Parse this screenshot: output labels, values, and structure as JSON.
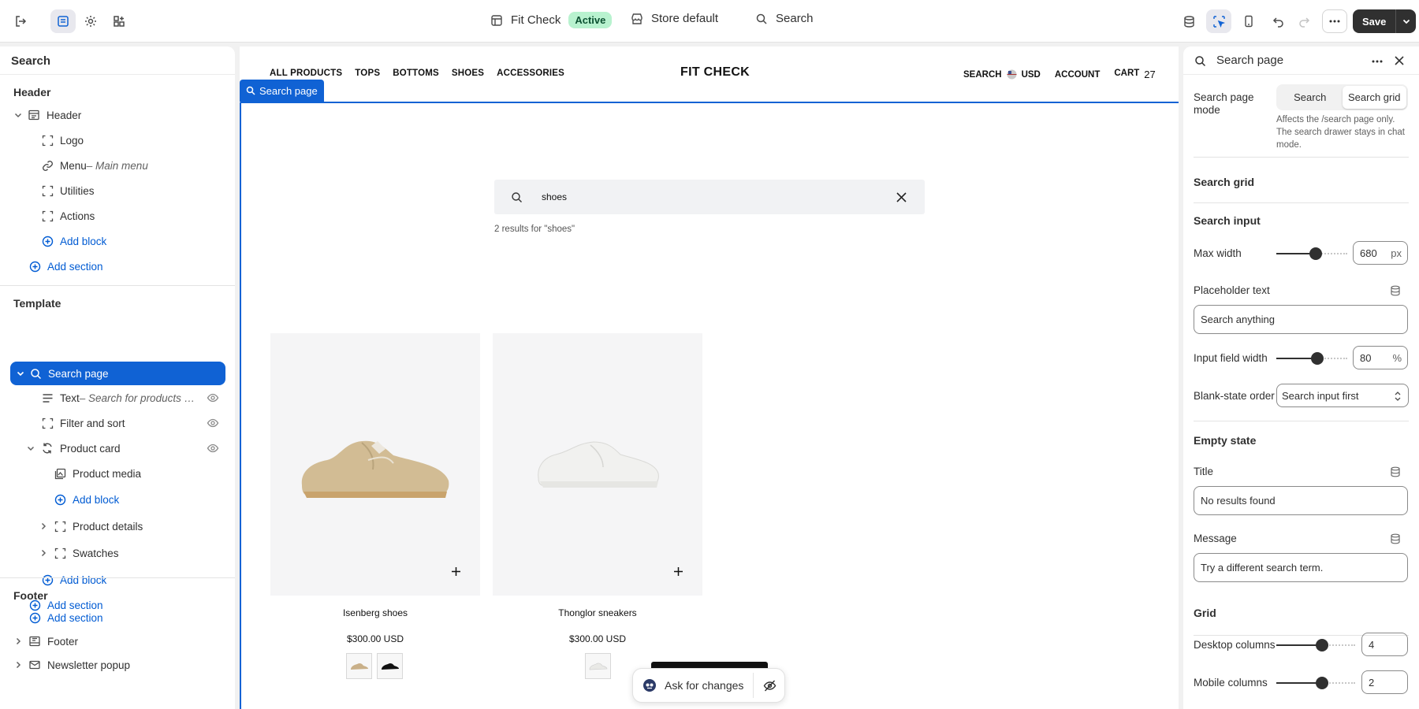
{
  "topbar": {
    "theme_name": "Fit Check",
    "theme_status": "Active",
    "store_label": "Store default",
    "search_label": "Search",
    "save_label": "Save"
  },
  "left_panel": {
    "title": "Search",
    "header_group": "Header",
    "header_section": "Header",
    "header_blocks": [
      {
        "label": "Logo",
        "sub": ""
      },
      {
        "label": "Menu",
        "sub": " – Main menu"
      },
      {
        "label": "Utilities",
        "sub": ""
      },
      {
        "label": "Actions",
        "sub": ""
      }
    ],
    "add_block": "Add block",
    "add_section": "Add section",
    "template_group": "Template",
    "template_section": "Search page",
    "template_blocks": {
      "text_label": "Text",
      "text_sub": " – Search for products Us...",
      "filter": "Filter and sort",
      "product_card": "Product card",
      "product_media": "Product media",
      "product_details": "Product details",
      "swatches": "Swatches"
    },
    "footer_group": "Footer",
    "footer_section": "Footer",
    "newsletter": "Newsletter popup"
  },
  "storefront": {
    "nav": [
      "ALL PRODUCTS",
      "TOPS",
      "BOTTOMS",
      "SHOES",
      "ACCESSORIES"
    ],
    "logo": "FIT CHECK",
    "search": "SEARCH",
    "currency": "USD",
    "account": "ACCOUNT",
    "cart": "CART",
    "cart_count": "27",
    "selection_tag": "Search page",
    "search_value": "shoes",
    "results_text": "2 results for \"shoes\"",
    "products": [
      {
        "name": "Isenberg shoes",
        "price": "$300.00 USD"
      },
      {
        "name": "Thonglor sneakers",
        "price": "$300.00 USD"
      }
    ],
    "ask_label": "Ask for changes"
  },
  "right_panel": {
    "title": "Search page",
    "mode_label": "Search page mode",
    "mode_options": [
      "Search",
      "Search grid"
    ],
    "mode_selected": "Search grid",
    "mode_help": "Affects the /search page only. The search drawer stays in chat mode.",
    "sec_search_grid": "Search grid",
    "sec_search_input": "Search input",
    "max_width_label": "Max width",
    "max_width_value": "680",
    "max_width_unit": "px",
    "placeholder_label": "Placeholder text",
    "placeholder_value": "Search anything",
    "input_width_label": "Input field width",
    "input_width_value": "80",
    "input_width_unit": "%",
    "blank_order_label": "Blank-state order",
    "blank_order_value": "Search input first",
    "sec_empty": "Empty state",
    "title_label": "Title",
    "title_value": "No results found",
    "message_label": "Message",
    "message_value": "Try a different search term.",
    "sec_grid": "Grid",
    "desktop_cols_label": "Desktop columns",
    "desktop_cols_value": "4",
    "mobile_cols_label": "Mobile columns",
    "mobile_cols_value": "2"
  },
  "colors": {
    "accent": "#1062d4",
    "link": "#005bd3",
    "active_badge": "#b8f2cf",
    "save": "#303030"
  },
  "icons": [
    "exit-icon",
    "sections-icon",
    "gear-icon",
    "apps-icon",
    "layout-icon",
    "store-icon",
    "search-icon",
    "database-icon",
    "inspector-icon",
    "mobile-icon",
    "undo-icon",
    "redo-icon",
    "more-icon",
    "chevron-down-icon",
    "close-icon",
    "plus-icon",
    "eye-icon",
    "eye-off-icon"
  ]
}
